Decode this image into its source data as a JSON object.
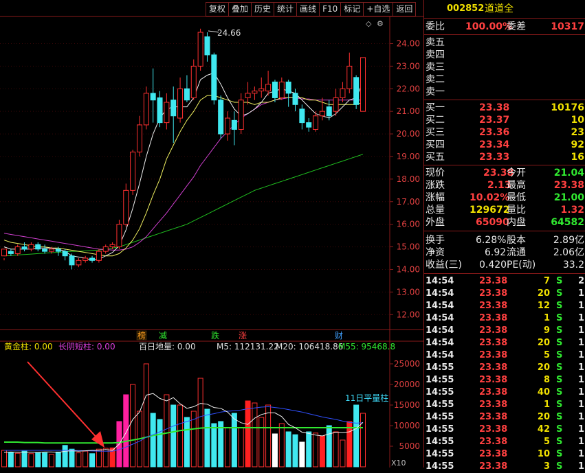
{
  "toolbar": {
    "buttons": [
      "复权",
      "叠加",
      "历史",
      "统计",
      "画线",
      "F10",
      "标记",
      "+自选",
      "返回"
    ]
  },
  "main_chart": {
    "high_label": "24.66",
    "price_ticks": [
      "24.00",
      "23.00",
      "22.00",
      "21.00",
      "20.00",
      "19.00",
      "18.00",
      "17.00",
      "16.00",
      "15.00",
      "14.00",
      "13.00",
      "12.00"
    ],
    "tags": [
      {
        "text": "榜",
        "color": "#ffa020"
      },
      {
        "text": "减",
        "color": "#30e830"
      },
      {
        "text": "跌",
        "color": "#30e830"
      },
      {
        "text": "涨",
        "color": "#ff4040"
      },
      {
        "text": "财",
        "color": "#40a0ff"
      }
    ]
  },
  "volume_panel": {
    "label_gold": "黄金柱: 0.00",
    "label_yinduan": "长阴短柱: 0.00",
    "label_baiidi": "百日地量: 0.00",
    "label_m5": "M5: 112131.22",
    "label_m20": "M20: 106418.86",
    "label_m55": "M55: 95468.8",
    "avg_label": "11日平量柱",
    "vol_ticks": [
      "25000",
      "20000",
      "15000",
      "10000",
      "5000"
    ],
    "unit": "X10"
  },
  "quote": {
    "code": "002852",
    "name": "道道全",
    "weibi_label": "委比",
    "weibi_value": "100.00%",
    "weicha_label": "委差",
    "weicha_value": "10317",
    "sell": [
      {
        "label": "卖五"
      },
      {
        "label": "卖四"
      },
      {
        "label": "卖三"
      },
      {
        "label": "卖二"
      },
      {
        "label": "卖一"
      }
    ],
    "buy": [
      {
        "label": "买一",
        "price": "23.38",
        "vol": "10176"
      },
      {
        "label": "买二",
        "price": "23.37",
        "vol": "10"
      },
      {
        "label": "买三",
        "price": "23.36",
        "vol": "23"
      },
      {
        "label": "买四",
        "price": "23.34",
        "vol": "92"
      },
      {
        "label": "买五",
        "price": "23.33",
        "vol": "16"
      }
    ],
    "stats": [
      {
        "l1": "现价",
        "v1": "23.38",
        "l2": "今开",
        "v2": "21.04"
      },
      {
        "l1": "涨跌",
        "v1": "2.13",
        "l2": "最高",
        "v2": "23.38"
      },
      {
        "l1": "涨幅",
        "v1": "10.02%",
        "l2": "最低",
        "v2": "21.00"
      },
      {
        "l1": "总量",
        "v1": "129672",
        "l2": "量比",
        "v2": "1.32"
      },
      {
        "l1": "外盘",
        "v1": "65090",
        "l2": "内盘",
        "v2": "64582"
      }
    ],
    "stats2": [
      {
        "l1": "换手",
        "v1": "6.28%",
        "l2": "股本",
        "v2": "2.89亿"
      },
      {
        "l1": "净资",
        "v1": "6.92",
        "l2": "流通",
        "v2": "2.06亿"
      },
      {
        "l1": "收益(三)",
        "v1": "0.420",
        "l2": "PE(动)",
        "v2": "33.2"
      }
    ]
  },
  "ticks": [
    {
      "t": "14:54",
      "p": "23.38",
      "v": "7",
      "s": "S",
      "n": "2"
    },
    {
      "t": "14:54",
      "p": "23.38",
      "v": "20",
      "s": "S",
      "n": "1"
    },
    {
      "t": "14:54",
      "p": "23.38",
      "v": "12",
      "s": "S",
      "n": "1"
    },
    {
      "t": "14:54",
      "p": "23.38",
      "v": "1",
      "s": "S",
      "n": "1"
    },
    {
      "t": "14:54",
      "p": "23.38",
      "v": "9",
      "s": "S",
      "n": "1"
    },
    {
      "t": "14:54",
      "p": "23.38",
      "v": "20",
      "s": "S",
      "n": "1"
    },
    {
      "t": "14:54",
      "p": "23.38",
      "v": "5",
      "s": "S",
      "n": "1"
    },
    {
      "t": "14:55",
      "p": "23.38",
      "v": "20",
      "s": "S",
      "n": "1"
    },
    {
      "t": "14:55",
      "p": "23.38",
      "v": "8",
      "s": "S",
      "n": "1"
    },
    {
      "t": "14:55",
      "p": "23.38",
      "v": "40",
      "s": "S",
      "n": "1"
    },
    {
      "t": "14:55",
      "p": "23.38",
      "v": "1",
      "s": "S",
      "n": "1"
    },
    {
      "t": "14:55",
      "p": "23.38",
      "v": "20",
      "s": "S",
      "n": "1"
    },
    {
      "t": "14:55",
      "p": "23.38",
      "v": "42",
      "s": "S",
      "n": "1"
    },
    {
      "t": "14:55",
      "p": "23.38",
      "v": "5",
      "s": "S",
      "n": "1"
    },
    {
      "t": "14:55",
      "p": "23.38",
      "v": "10",
      "s": "S",
      "n": "1"
    },
    {
      "t": "14:55",
      "p": "23.38",
      "v": "3",
      "s": "S",
      "n": "1"
    }
  ],
  "chart_data": {
    "type": "candlestick",
    "candles": [
      [
        14.6,
        14.9,
        14.5,
        14.4
      ],
      [
        14.8,
        14.7,
        14.9,
        14.6
      ],
      [
        14.7,
        15.0,
        15.1,
        14.6
      ],
      [
        15.0,
        14.9,
        15.2,
        14.8
      ],
      [
        14.9,
        15.1,
        15.2,
        14.8
      ],
      [
        15.1,
        14.9,
        15.2,
        14.8
      ],
      [
        14.9,
        14.8,
        15.1,
        14.7
      ],
      [
        14.8,
        14.9,
        15.0,
        14.7
      ],
      [
        14.9,
        14.8,
        15.0,
        14.6
      ],
      [
        14.8,
        14.6,
        14.9,
        14.4
      ],
      [
        14.6,
        14.2,
        14.7,
        14.0
      ],
      [
        14.2,
        14.4,
        14.5,
        14.1
      ],
      [
        14.4,
        14.5,
        14.6,
        14.3
      ],
      [
        14.5,
        14.4,
        14.6,
        14.3
      ],
      [
        14.4,
        14.8,
        14.9,
        14.3
      ],
      [
        14.8,
        15.0,
        15.1,
        14.7
      ],
      [
        15.0,
        15.1,
        15.2,
        14.9
      ],
      [
        15.0,
        16.0,
        16.2,
        14.9
      ],
      [
        16.0,
        17.5,
        17.8,
        15.9
      ],
      [
        17.5,
        19.2,
        19.3,
        17.3
      ],
      [
        19.2,
        20.4,
        20.8,
        19.0
      ],
      [
        20.4,
        21.8,
        22.1,
        20.2
      ],
      [
        21.8,
        21.5,
        22.9,
        20.5
      ],
      [
        21.6,
        20.5,
        21.9,
        20.3
      ],
      [
        20.5,
        21.4,
        21.8,
        20.2
      ],
      [
        21.5,
        20.8,
        22.1,
        19.6
      ],
      [
        20.7,
        22.0,
        22.5,
        20.5
      ],
      [
        22.0,
        21.5,
        22.6,
        21.4
      ],
      [
        21.6,
        23.0,
        23.3,
        21.5
      ],
      [
        23.0,
        24.5,
        24.66,
        22.8
      ],
      [
        24.3,
        23.5,
        24.5,
        23.2
      ],
      [
        23.5,
        21.5,
        23.6,
        21.3
      ],
      [
        21.5,
        20.0,
        21.7,
        19.8
      ],
      [
        20.0,
        20.7,
        21.0,
        19.7
      ],
      [
        20.6,
        20.2,
        21.0,
        19.5
      ],
      [
        20.2,
        21.5,
        21.8,
        20.0
      ],
      [
        21.6,
        21.8,
        22.3,
        21.3
      ],
      [
        21.8,
        21.9,
        22.1,
        21.5
      ],
      [
        21.9,
        22.0,
        22.5,
        21.6
      ],
      [
        21.9,
        22.2,
        22.8,
        21.7
      ],
      [
        22.3,
        21.6,
        22.4,
        21.4
      ],
      [
        21.6,
        22.3,
        22.5,
        21.5
      ],
      [
        22.3,
        21.8,
        22.4,
        21.2
      ],
      [
        21.8,
        21.3,
        22.0,
        21.0
      ],
      [
        21.1,
        20.5,
        21.3,
        20.2
      ],
      [
        20.5,
        20.3,
        20.7,
        20.1
      ],
      [
        20.2,
        20.8,
        21.0,
        20.1
      ],
      [
        20.8,
        21.0,
        21.6,
        20.6
      ],
      [
        21.2,
        20.8,
        21.5,
        20.6
      ],
      [
        21.0,
        21.6,
        22.0,
        20.8
      ],
      [
        21.6,
        22.0,
        22.3,
        21.4
      ],
      [
        22.0,
        23.0,
        23.6,
        21.8
      ],
      [
        22.5,
        21.3,
        22.6,
        21.1
      ],
      [
        21.0,
        23.38,
        23.38,
        21.0
      ]
    ],
    "ma5": [
      15.0,
      14.9,
      14.9,
      14.9,
      14.9,
      14.95,
      14.95,
      14.95,
      14.9,
      14.8,
      14.6,
      14.55,
      14.5,
      14.4,
      14.45,
      14.6,
      14.75,
      15.05,
      15.75,
      16.7,
      17.8,
      19.0,
      20.0,
      20.7,
      21.1,
      21.2,
      21.2,
      21.2,
      21.6,
      22.4,
      22.6,
      22.7,
      22.2,
      21.6,
      21.1,
      20.8,
      20.9,
      21.1,
      21.4,
      21.8,
      21.9,
      22.0,
      21.9,
      21.8,
      21.5,
      21.2,
      20.9,
      20.8,
      20.7,
      20.9,
      21.2,
      21.5,
      21.6,
      22.3
    ],
    "ma10": [
      15.3,
      15.2,
      15.15,
      15.1,
      15.05,
      15.0,
      15.0,
      14.95,
      14.95,
      14.9,
      14.85,
      14.8,
      14.75,
      14.7,
      14.65,
      14.6,
      14.6,
      14.7,
      14.95,
      15.3,
      15.8,
      16.5,
      17.3,
      18.0,
      18.9,
      19.5,
      20.1,
      20.6,
      21.0,
      21.5,
      21.7,
      21.7,
      21.6,
      21.5,
      21.4,
      21.4,
      21.4,
      21.3,
      21.4,
      21.4,
      21.5,
      21.6,
      21.6,
      21.6,
      21.6,
      21.5,
      21.5,
      21.4,
      21.3,
      21.3,
      21.3,
      21.3,
      21.3,
      21.4
    ],
    "ma20": [
      15.6,
      15.55,
      15.5,
      15.45,
      15.4,
      15.35,
      15.3,
      15.25,
      15.2,
      15.15,
      15.1,
      15.05,
      15.0,
      14.95,
      14.9,
      14.88,
      14.86,
      14.86,
      14.9,
      15.0,
      15.2,
      15.45,
      15.8,
      16.15,
      16.5,
      16.9,
      17.3,
      17.7,
      18.1,
      18.6,
      19.0,
      19.4,
      19.8,
      20.1,
      20.4,
      20.7,
      20.9,
      21.1,
      21.3,
      21.4,
      21.5,
      21.55,
      21.6,
      21.6,
      21.55,
      21.55,
      21.5,
      21.5,
      21.5,
      21.5,
      21.5,
      21.5,
      21.5,
      21.5
    ],
    "ma60": [
      14.6,
      14.62,
      14.64,
      14.66,
      14.68,
      14.7,
      14.72,
      14.74,
      14.76,
      14.78,
      14.8,
      14.8,
      14.82,
      14.84,
      14.86,
      14.9,
      14.95,
      15.0,
      15.1,
      15.2,
      15.3,
      15.4,
      15.5,
      15.6,
      15.7,
      15.8,
      15.9,
      16.0,
      16.15,
      16.3,
      16.45,
      16.6,
      16.75,
      16.9,
      17.05,
      17.2,
      17.35,
      17.5,
      17.6,
      17.7,
      17.8,
      17.9,
      18.0,
      18.1,
      18.2,
      18.3,
      18.4,
      18.5,
      18.6,
      18.7,
      18.8,
      18.9,
      19.0,
      19.1
    ],
    "volumes": [
      4000,
      3500,
      3300,
      3800,
      3200,
      3500,
      3400,
      3000,
      3600,
      5200,
      4300,
      3400,
      3800,
      3200,
      4300,
      4500,
      4600,
      11000,
      17500,
      20000,
      13500,
      25000,
      13000,
      11500,
      17500,
      15000,
      15000,
      12000,
      13500,
      21500,
      14000,
      10500,
      11000,
      9500,
      13000,
      9500,
      16000,
      15500,
      12000,
      15000,
      8000,
      10500,
      8500,
      7800,
      6000,
      8500,
      8200,
      7500,
      10000,
      8500,
      6500,
      11000,
      15000,
      13000
    ],
    "vol_ma5": [
      3500,
      3600,
      3550,
      3550,
      3550,
      3500,
      3600,
      3600,
      3500,
      3800,
      3900,
      3800,
      3900,
      4000,
      4000,
      4200,
      4000,
      5500,
      8300,
      11500,
      13300,
      17400,
      17800,
      16600,
      16000,
      16800,
      15300,
      14200,
      14600,
      15400,
      15200,
      14400,
      14200,
      13300,
      11600,
      10700,
      10300,
      11800,
      12700,
      13100,
      13100,
      12200,
      10300,
      9500,
      8400,
      8100,
      7700,
      7500,
      8000,
      8400,
      8300,
      8500,
      9300,
      10800
    ],
    "vol_ma20": [
      4000,
      4000,
      4000,
      4000,
      4000,
      4000,
      4000,
      4000,
      4000,
      4000,
      4000,
      3950,
      3900,
      3850,
      3800,
      3800,
      3800,
      4200,
      4800,
      5500,
      6200,
      7200,
      7800,
      8500,
      9200,
      9900,
      10500,
      11000,
      11500,
      12200,
      12600,
      12900,
      13300,
      13500,
      13600,
      13800,
      14100,
      14300,
      14500,
      14600,
      14400,
      14200,
      13900,
      13600,
      13300,
      12900,
      12500,
      12100,
      11800,
      11500,
      11100,
      10800,
      10600,
      10700
    ],
    "vol_ma55": [
      6000,
      6000,
      6000,
      5900,
      5900,
      5900,
      5800,
      5800,
      5800,
      5800,
      5800,
      5800,
      5800,
      5800,
      5800,
      5800,
      5800,
      5900,
      6200,
      6500,
      6800,
      7200,
      7600,
      7900,
      8200,
      8500,
      8800,
      9000,
      9200,
      9400,
      9500,
      9500,
      9500,
      9500,
      9500,
      9500,
      9500,
      9500,
      9500,
      9500,
      9500,
      9500,
      9500,
      9500,
      9500,
      9500,
      9500,
      9500,
      9500,
      9500,
      9500,
      9500,
      9500,
      9500
    ],
    "price_range": [
      11.4,
      25.2
    ],
    "volume_range": [
      0,
      28000
    ],
    "y_ticks": [
      24,
      23,
      22,
      21,
      20,
      19,
      18,
      17,
      16,
      15,
      14,
      13,
      12
    ],
    "vol_ticks": [
      25000,
      20000,
      15000,
      10000,
      5000
    ]
  }
}
